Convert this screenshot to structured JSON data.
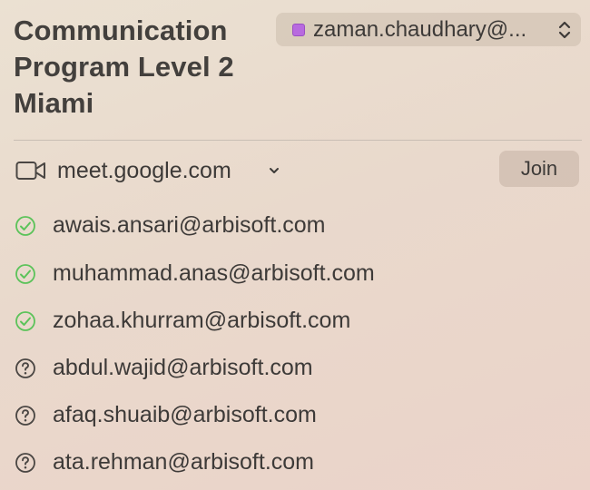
{
  "event": {
    "title_lines": [
      "Communication",
      "Program Level 2",
      "Miami"
    ]
  },
  "calendar": {
    "account": "zaman.chaudhary@...",
    "color": "#b86adf"
  },
  "location": {
    "icon": "video-camera-icon",
    "text": "meet.google.com",
    "join_label": "Join"
  },
  "attendees": [
    {
      "email": "awais.ansari@arbisoft.com",
      "status": "accepted",
      "icon": "check-circle-icon"
    },
    {
      "email": "muhammad.anas@arbisoft.com",
      "status": "accepted",
      "icon": "check-circle-icon"
    },
    {
      "email": "zohaa.khurram@arbisoft.com",
      "status": "accepted",
      "icon": "check-circle-icon"
    },
    {
      "email": "abdul.wajid@arbisoft.com",
      "status": "unknown",
      "icon": "question-circle-icon"
    },
    {
      "email": "afaq.shuaib@arbisoft.com",
      "status": "unknown",
      "icon": "question-circle-icon"
    },
    {
      "email": "ata.rehman@arbisoft.com",
      "status": "unknown",
      "icon": "question-circle-icon"
    }
  ],
  "colors": {
    "accepted": "#5cc35a",
    "unknown": "#4a4643"
  }
}
